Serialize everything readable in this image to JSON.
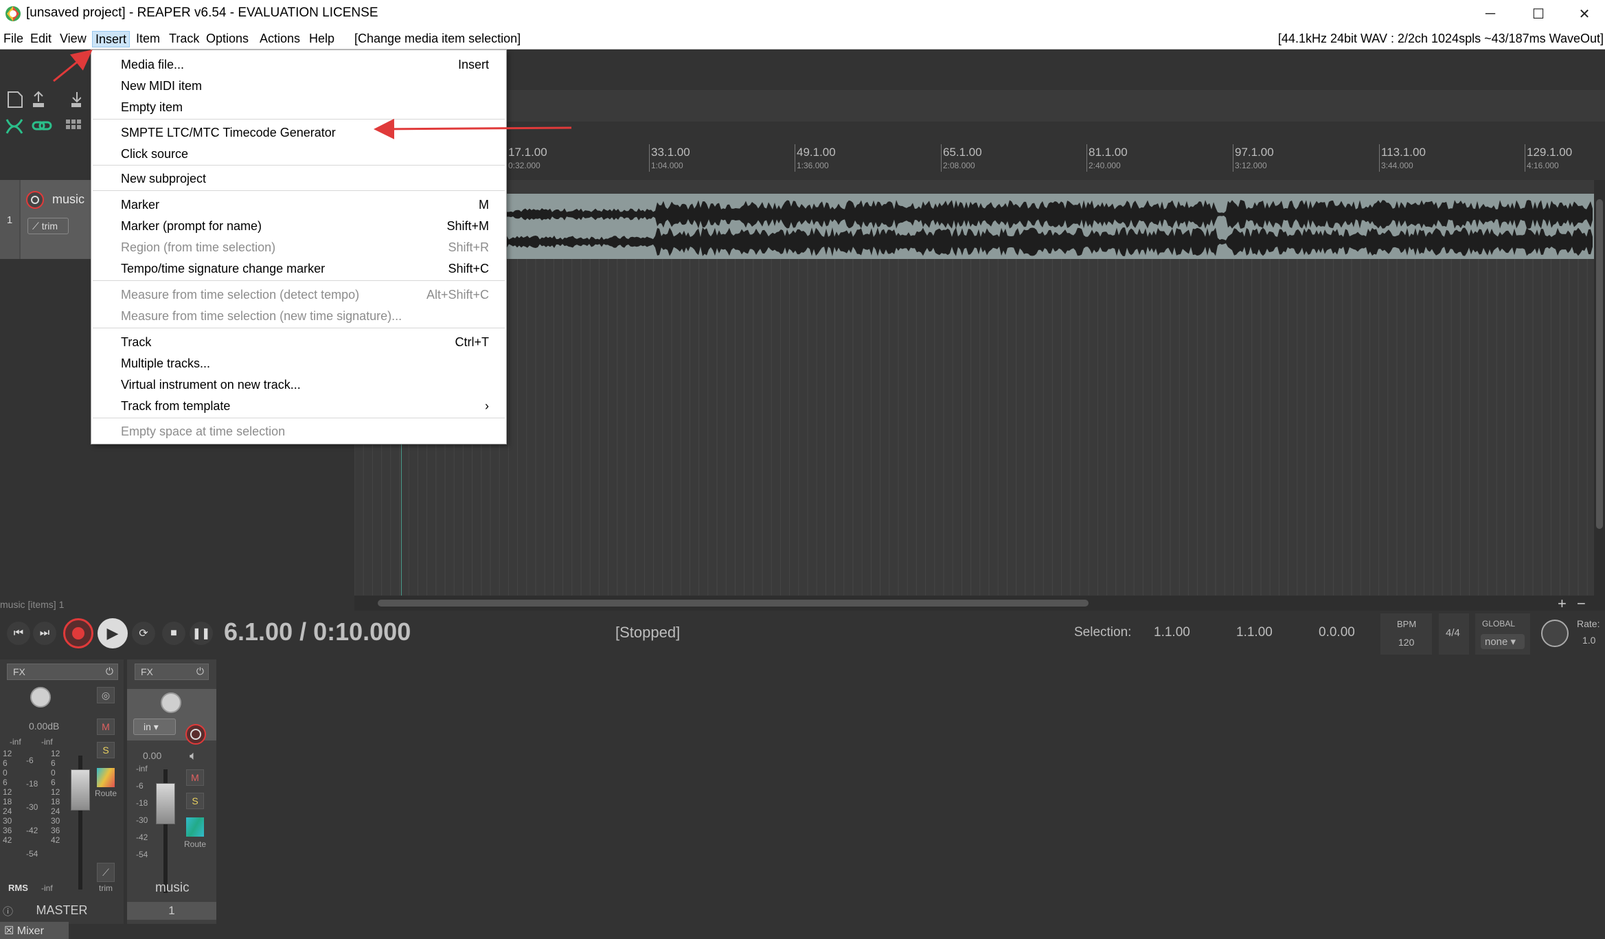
{
  "window": {
    "title": "[unsaved project] - REAPER v6.54 - EVALUATION LICENSE",
    "minimize_glyph": "─",
    "maximize_glyph": "☐",
    "close_glyph": "✕"
  },
  "menubar": {
    "items": [
      "File",
      "Edit",
      "View",
      "Insert",
      "Item",
      "Track",
      "Options",
      "Actions",
      "Help"
    ],
    "context_hint": "[Change media item selection]",
    "status": "[44.1kHz 24bit WAV : 2/2ch 1024spls ~43/187ms WaveOut]",
    "active": "Insert"
  },
  "insert_menu": {
    "items": [
      {
        "label": "Media file...",
        "shortcut": "Insert",
        "disabled": false
      },
      {
        "label": "New MIDI item",
        "shortcut": "",
        "disabled": false
      },
      {
        "label": "Empty item",
        "shortcut": "",
        "disabled": false
      },
      {
        "label": "SMPTE LTC/MTC Timecode Generator",
        "shortcut": "",
        "disabled": false
      },
      {
        "label": "Click source",
        "shortcut": "",
        "disabled": false
      },
      {
        "label": "New subproject",
        "shortcut": "",
        "disabled": false
      },
      {
        "label": "Marker",
        "shortcut": "M",
        "disabled": false
      },
      {
        "label": "Marker (prompt for name)",
        "shortcut": "Shift+M",
        "disabled": false
      },
      {
        "label": "Region (from time selection)",
        "shortcut": "Shift+R",
        "disabled": true
      },
      {
        "label": "Tempo/time signature change marker",
        "shortcut": "Shift+C",
        "disabled": false
      },
      {
        "label": "Measure from time selection (detect tempo)",
        "shortcut": "Alt+Shift+C",
        "disabled": true
      },
      {
        "label": "Measure from time selection (new time signature)...",
        "shortcut": "",
        "disabled": true
      },
      {
        "label": "Track",
        "shortcut": "Ctrl+T",
        "disabled": false
      },
      {
        "label": "Multiple tracks...",
        "shortcut": "",
        "disabled": false
      },
      {
        "label": "Virtual instrument on new track...",
        "shortcut": "",
        "disabled": false
      },
      {
        "label": "Track from template",
        "shortcut": "›",
        "disabled": false
      },
      {
        "label": "Empty space at time selection",
        "shortcut": "",
        "disabled": true
      }
    ]
  },
  "ruler": {
    "marks": [
      {
        "bar": "17.1.00",
        "time": "0:32.000"
      },
      {
        "bar": "33.1.00",
        "time": "1:04.000"
      },
      {
        "bar": "49.1.00",
        "time": "1:36.000"
      },
      {
        "bar": "65.1.00",
        "time": "2:08.000"
      },
      {
        "bar": "81.1.00",
        "time": "2:40.000"
      },
      {
        "bar": "97.1.00",
        "time": "3:12.000"
      },
      {
        "bar": "113.1.00",
        "time": "3:44.000"
      },
      {
        "bar": "129.1.00",
        "time": "4:16.000"
      }
    ]
  },
  "track": {
    "number": "1",
    "name": "music",
    "trim": "trim"
  },
  "items_label": "music [items] 1",
  "transport": {
    "position": "6.1.00 / 0:10.000",
    "state": "[Stopped]",
    "selection_label": "Selection:",
    "sel_start": "1.1.00",
    "sel_end": "1.1.00",
    "sel_length": "0.0.00",
    "bpm_label": "BPM",
    "bpm": "120",
    "time_sig": "4/4",
    "global_label": "GLOBAL",
    "global_value": "none",
    "rate_label": "Rate:",
    "rate": "1.0"
  },
  "mixer": {
    "fx": "FX",
    "master_vol": "0.00dB",
    "master_peak_l": "-inf",
    "master_peak_r": "-inf",
    "rms": "RMS",
    "rms_value": "-inf",
    "route": "Route",
    "trim": "trim",
    "master_name": "MASTER",
    "music_vol": "0.00",
    "music_peak": "-inf",
    "music_in": "in",
    "music_name": "music",
    "music_num": "1",
    "mute": "M",
    "solo": "S",
    "scale_left": [
      "12",
      "6",
      "0",
      "6",
      "12",
      "18",
      "24",
      "30",
      "36",
      "42"
    ],
    "scale_mid": [
      "-6",
      "-18",
      "-30",
      "-42",
      "-54"
    ],
    "scale_music": [
      "-inf",
      "-6",
      "-18",
      "-30",
      "-42",
      "-54"
    ],
    "tab": "Mixer"
  },
  "colors": {
    "accent_red": "#e03a3a",
    "menu_highlight": "#cce4f7",
    "item_bg": "#8d9a9a"
  }
}
